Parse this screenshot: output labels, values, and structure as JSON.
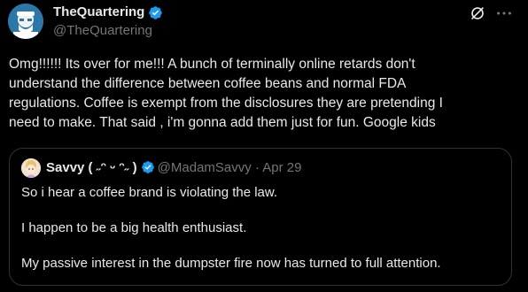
{
  "post": {
    "author": {
      "display_name": "TheQuartering",
      "handle": "@TheQuartering",
      "verified": true
    },
    "actions": {
      "grok_icon": "grok-icon",
      "more_icon": "more-icon"
    },
    "text_lines": [
      "Omg!!!!!!  Its over for me!!! A bunch of terminally online retards don't",
      "understand the difference between coffee beans and normal FDA",
      "regulations. Coffee is exempt from the disclosures they are pretending I",
      "need to make.  That said , i'm gonna add them just for fun. Google kids"
    ]
  },
  "quoted_post": {
    "author": {
      "display_name": "Savvy ( ˶ᵔ ᵕ ᵔ˶ )",
      "handle": "@MadamSavvy",
      "verified": true
    },
    "separator": "·",
    "date": "Apr 29",
    "lines": [
      "So i hear a coffee brand is violating the law.",
      "I happen to be a big health enthusiast.",
      "My passive interest in the dumpster fire now has turned to full attention."
    ]
  },
  "colors": {
    "background": "#000000",
    "text_primary": "#e7e9ea",
    "text_secondary": "#71767b",
    "verified_blue": "#1d9bf0",
    "border": "#2f3336"
  }
}
